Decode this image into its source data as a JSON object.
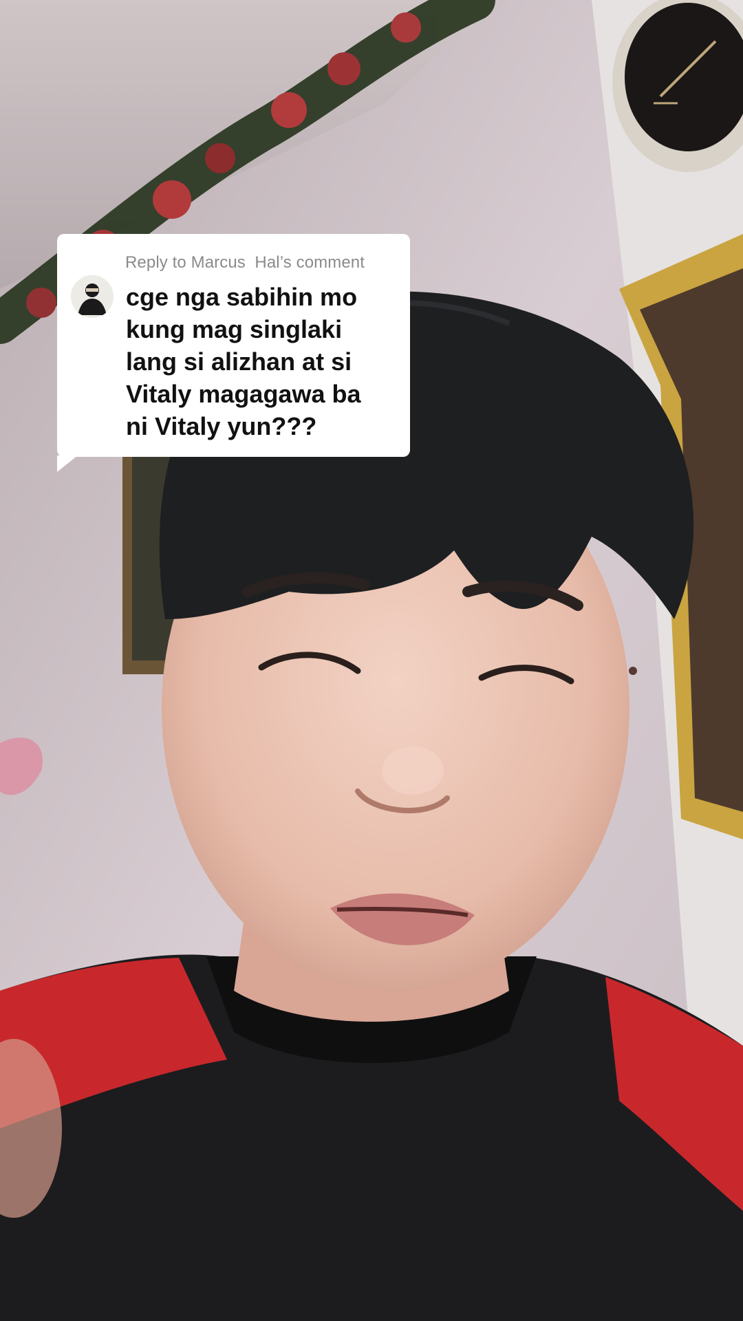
{
  "reply": {
    "header": "Reply to Marcus  Hal’s comment",
    "avatar_icon": "commenter-avatar",
    "lines": [
      "cge nga sabihin mo",
      "kung mag singlaki",
      "lang si alizhan at si",
      "Vitaly magagawa ba",
      "ni Vitaly yun???"
    ]
  },
  "colors": {
    "bubble": "#ffffff",
    "header_text": "#8a8a8a",
    "body_text": "#111111",
    "shirt_red": "#c8282c",
    "shirt_black": "#1c1c1e"
  }
}
